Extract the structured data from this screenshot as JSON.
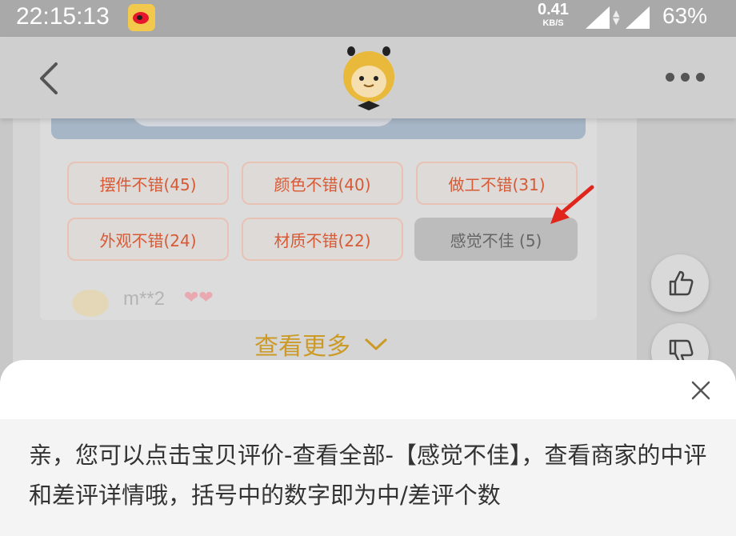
{
  "status_bar": {
    "time": "22:15:13",
    "net_speed": "0.41",
    "net_unit": "KB/S",
    "battery": "63%"
  },
  "tags": [
    {
      "label": "摆件不错(45)",
      "type": "positive"
    },
    {
      "label": "颜色不错(40)",
      "type": "positive"
    },
    {
      "label": "做工不错(31)",
      "type": "positive"
    },
    {
      "label": "外观不错(24)",
      "type": "positive"
    },
    {
      "label": "材质不错(22)",
      "type": "positive"
    },
    {
      "label": "感觉不佳 (5)",
      "type": "negative"
    }
  ],
  "review": {
    "user": "m**2",
    "hearts": "❤❤"
  },
  "see_more": "查看更多",
  "tip": {
    "text": "亲，您可以点击宝贝评价-查看全部-【感觉不佳】，查看商家的中评和差评详情哦，括号中的数字即为中/差评个数"
  },
  "colors": {
    "tag_text": "#d65a36",
    "accent": "#cc9a26",
    "annotation_arrow": "#e0261c"
  },
  "icons": [
    "weibo-icon",
    "signal-icon",
    "back-icon",
    "mascot-logo",
    "more-icon",
    "thumbs-up-icon",
    "thumbs-down-icon",
    "close-icon"
  ]
}
